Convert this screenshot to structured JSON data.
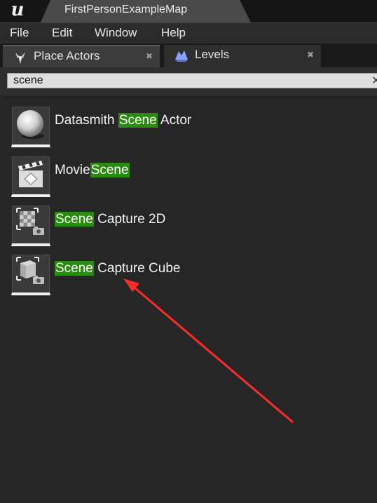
{
  "window": {
    "title": "FirstPersonExampleMap",
    "logo": "unreal-logo"
  },
  "menu": [
    "File",
    "Edit",
    "Window",
    "Help"
  ],
  "tabs": [
    {
      "label": "Place Actors",
      "icon": "place-actors-icon",
      "active": true
    },
    {
      "label": "Levels",
      "icon": "levels-icon",
      "active": false
    }
  ],
  "search": {
    "value": "scene",
    "clear_icon": "close-icon"
  },
  "results": [
    {
      "before": "Datasmith ",
      "match": "Scene",
      "after": " Actor",
      "icon": "sphere-icon"
    },
    {
      "before": "Movie",
      "match": "Scene",
      "after": "",
      "icon": "clapperboard-icon"
    },
    {
      "before": "",
      "match": "Scene",
      "after": " Capture 2D",
      "icon": "scene-capture-2d-icon"
    },
    {
      "before": "",
      "match": "Scene",
      "after": " Capture Cube",
      "icon": "scene-capture-cube-icon"
    }
  ],
  "colors": {
    "highlight": "#2a8c0f",
    "arrow": "#ff2b2b"
  }
}
